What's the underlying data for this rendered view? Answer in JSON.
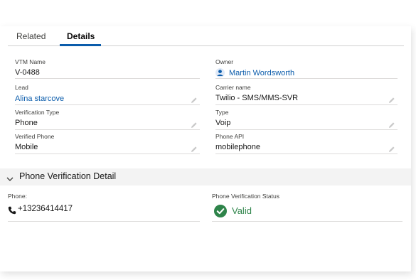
{
  "tabs": [
    {
      "label": "Related"
    },
    {
      "label": "Details"
    }
  ],
  "details": {
    "vtm_name_label": "VTM Name",
    "vtm_name_value": "V-0488",
    "owner_label": "Owner",
    "owner_value": "Martin Wordsworth",
    "lead_label": "Lead",
    "lead_value": "Alina starcove",
    "carrier_label": "Carrier name",
    "carrier_value": "Twilio - SMS/MMS-SVR",
    "verification_type_label": "Verification Type",
    "verification_type_value": "Phone",
    "type_label": "Type",
    "type_value": "Voip",
    "verified_phone_label": "Verified Phone",
    "verified_phone_value": "Mobile",
    "phone_api_label": "Phone API",
    "phone_api_value": "mobilephone"
  },
  "section": {
    "title": "Phone Verification Detail",
    "phone_label": "Phone:",
    "phone_value": "+13236414417",
    "status_label": "Phone Verification Status",
    "status_value": "Valid"
  },
  "colors": {
    "link": "#0b5cab",
    "active_tab": "#0b5cab",
    "valid": "#2e844a",
    "section_bg": "#f3f3f3"
  },
  "icons": [
    "pencil-icon",
    "chevron-down-icon",
    "phone-icon",
    "check-circle-icon",
    "user-avatar-icon"
  ]
}
